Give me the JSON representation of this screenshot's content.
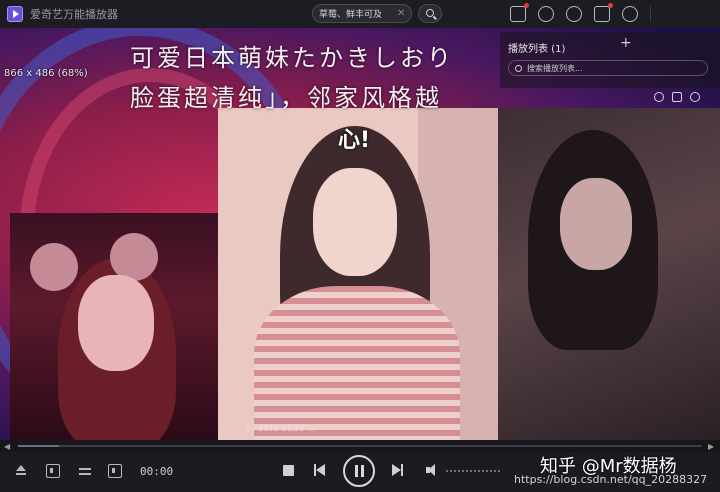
{
  "app": {
    "title": "爱奇艺万能播放器"
  },
  "search": {
    "value": "草莓、鲜丰可及",
    "clear_glyph": "✕"
  },
  "video": {
    "resolution": "866 x 486 (68%)",
    "caption_line1": "可爱日本萌妹たかきしおり",
    "caption_line2": "脸蛋超清纯」，邻家风格越",
    "sticker": "心!",
    "tag": "by 2019  01/20 ..."
  },
  "playlist": {
    "title": "播放列表 (1)",
    "add_glyph": "+",
    "search_placeholder": "搜索播放列表..."
  },
  "seek": {
    "left_glyph": "◀",
    "right_glyph": "▶",
    "progress": 0.06
  },
  "controls": {
    "time": "00:00"
  },
  "watermark": {
    "brand": "知乎 @Mr数据杨",
    "url": "https://blog.csdn.net/qq_20288327"
  },
  "colors": {
    "accent": "#6b4fd8",
    "notification": "#e23b3b"
  }
}
